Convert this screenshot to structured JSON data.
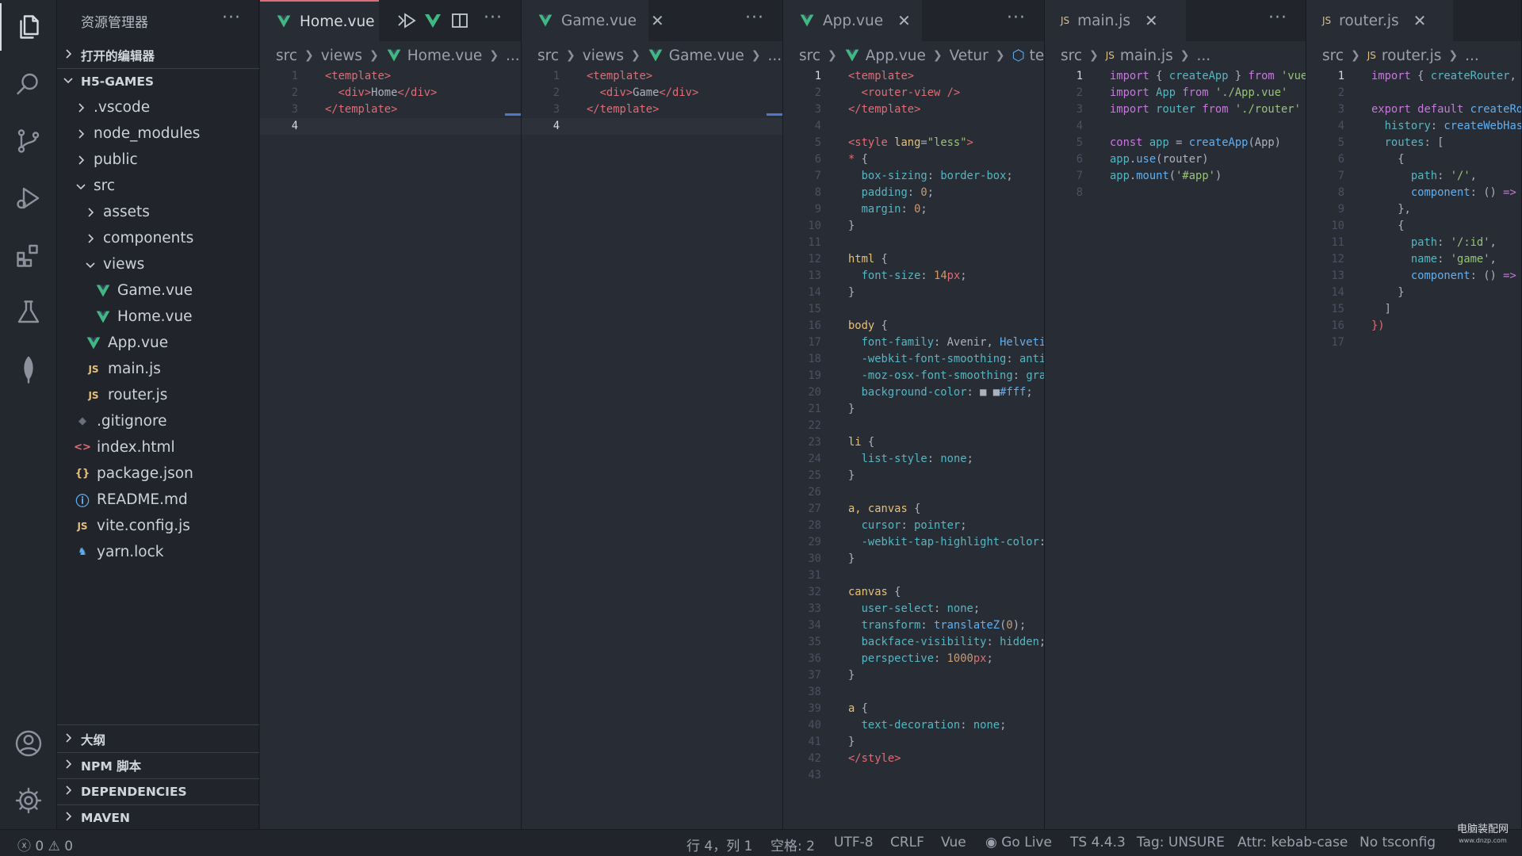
{
  "sidebar": {
    "title": "资源管理器",
    "more": "···",
    "open_editors": "打开的编辑器",
    "project": "H5-GAMES",
    "tree": [
      {
        "label": ".vscode",
        "type": "folder"
      },
      {
        "label": "node_modules",
        "type": "folder"
      },
      {
        "label": "public",
        "type": "folder"
      },
      {
        "label": "src",
        "type": "folder-open"
      },
      {
        "label": "assets",
        "type": "folder"
      },
      {
        "label": "components",
        "type": "folder"
      },
      {
        "label": "views",
        "type": "folder-open"
      },
      {
        "label": "Game.vue",
        "type": "vue"
      },
      {
        "label": "Home.vue",
        "type": "vue"
      },
      {
        "label": "App.vue",
        "type": "vue"
      },
      {
        "label": "main.js",
        "type": "js"
      },
      {
        "label": "router.js",
        "type": "js"
      },
      {
        "label": ".gitignore",
        "type": "git"
      },
      {
        "label": "index.html",
        "type": "html"
      },
      {
        "label": "package.json",
        "type": "json"
      },
      {
        "label": "README.md",
        "type": "info"
      },
      {
        "label": "vite.config.js",
        "type": "js"
      },
      {
        "label": "yarn.lock",
        "type": "yarn"
      }
    ],
    "sections": [
      "大纲",
      "NPM 脚本",
      "DEPENDENCIES",
      "MAVEN"
    ]
  },
  "editors": [
    {
      "tab": "Home.vue",
      "crumbs": [
        "src",
        "views",
        "Home.vue",
        "..."
      ],
      "lines": [
        [
          [
            "t-tag",
            "<template>"
          ]
        ],
        [
          [
            "t-plain",
            "  "
          ],
          [
            "t-tag",
            "<div>"
          ],
          [
            "t-plain",
            "Home"
          ],
          [
            "t-tag",
            "</div>"
          ]
        ],
        [
          [
            "t-tag",
            "</template>"
          ]
        ],
        []
      ]
    },
    {
      "tab": "Game.vue",
      "crumbs": [
        "src",
        "views",
        "Game.vue",
        "..."
      ],
      "lines": [
        [
          [
            "t-tag",
            "<template>"
          ]
        ],
        [
          [
            "t-plain",
            "  "
          ],
          [
            "t-tag",
            "<div>"
          ],
          [
            "t-plain",
            "Game"
          ],
          [
            "t-tag",
            "</div>"
          ]
        ],
        [
          [
            "t-tag",
            "</template>"
          ]
        ],
        []
      ]
    },
    {
      "tab": "App.vue",
      "crumbs": [
        "src",
        "App.vue",
        "Vetur",
        "tem"
      ],
      "lines": [
        [
          [
            "t-tag",
            "<template>"
          ]
        ],
        [
          [
            "t-plain",
            "  "
          ],
          [
            "t-tag",
            "<router-view />"
          ]
        ],
        [
          [
            "t-tag",
            "</template>"
          ]
        ],
        [],
        [
          [
            "t-tag",
            "<style "
          ],
          [
            "t-sel",
            "lang"
          ],
          [
            "t-plain",
            "="
          ],
          [
            "t-str",
            "\"less\""
          ],
          [
            "t-tag",
            ">"
          ]
        ],
        [
          [
            "t-tag",
            "* "
          ],
          [
            "t-plain",
            "{"
          ]
        ],
        [
          [
            "t-plain",
            "  "
          ],
          [
            "t-prop",
            "box-sizing"
          ],
          [
            "t-plain",
            ": "
          ],
          [
            "t-prop",
            "border-box"
          ],
          [
            "t-plain",
            ";"
          ]
        ],
        [
          [
            "t-plain",
            "  "
          ],
          [
            "t-prop",
            "padding"
          ],
          [
            "t-plain",
            ": "
          ],
          [
            "t-num",
            "0"
          ],
          [
            "t-plain",
            ";"
          ]
        ],
        [
          [
            "t-plain",
            "  "
          ],
          [
            "t-prop",
            "margin"
          ],
          [
            "t-plain",
            ": "
          ],
          [
            "t-num",
            "0"
          ],
          [
            "t-plain",
            ";"
          ]
        ],
        [
          [
            "t-plain",
            "}"
          ]
        ],
        [],
        [
          [
            "t-sel",
            "html "
          ],
          [
            "t-plain",
            "{"
          ]
        ],
        [
          [
            "t-plain",
            "  "
          ],
          [
            "t-prop",
            "font-size"
          ],
          [
            "t-plain",
            ": "
          ],
          [
            "t-num",
            "14"
          ],
          [
            "t-tag",
            "px"
          ],
          [
            "t-plain",
            ";"
          ]
        ],
        [
          [
            "t-plain",
            "}"
          ]
        ],
        [],
        [
          [
            "t-sel",
            "body "
          ],
          [
            "t-plain",
            "{"
          ]
        ],
        [
          [
            "t-plain",
            "  "
          ],
          [
            "t-prop",
            "font-family"
          ],
          [
            "t-plain",
            ": Avenir, "
          ],
          [
            "t-fn",
            "Helveti"
          ]
        ],
        [
          [
            "t-plain",
            "  "
          ],
          [
            "t-prop",
            "-webkit-font-smoothing"
          ],
          [
            "t-plain",
            ": "
          ],
          [
            "t-prop",
            "anti"
          ]
        ],
        [
          [
            "t-plain",
            "  "
          ],
          [
            "t-prop",
            "-moz-osx-font-smoothing"
          ],
          [
            "t-plain",
            ": "
          ],
          [
            "t-prop",
            "gra"
          ]
        ],
        [
          [
            "t-plain",
            "  "
          ],
          [
            "t-prop",
            "background-color"
          ],
          [
            "t-plain",
            ": "
          ],
          [
            "t-plain",
            "■"
          ],
          [
            "t-plain",
            " ■"
          ],
          [
            "t-fn",
            "#fff"
          ],
          [
            "t-plain",
            ";"
          ]
        ],
        [
          [
            "t-plain",
            "}"
          ]
        ],
        [],
        [
          [
            "t-sel",
            "li "
          ],
          [
            "t-plain",
            "{"
          ]
        ],
        [
          [
            "t-plain",
            "  "
          ],
          [
            "t-prop",
            "list-style"
          ],
          [
            "t-plain",
            ": "
          ],
          [
            "t-prop",
            "none"
          ],
          [
            "t-plain",
            ";"
          ]
        ],
        [
          [
            "t-plain",
            "}"
          ]
        ],
        [],
        [
          [
            "t-sel",
            "a, canvas "
          ],
          [
            "t-plain",
            "{"
          ]
        ],
        [
          [
            "t-plain",
            "  "
          ],
          [
            "t-prop",
            "cursor"
          ],
          [
            "t-plain",
            ": "
          ],
          [
            "t-prop",
            "pointer"
          ],
          [
            "t-plain",
            ";"
          ]
        ],
        [
          [
            "t-plain",
            "  "
          ],
          [
            "t-prop",
            "-webkit-tap-highlight-color"
          ],
          [
            "t-plain",
            ":"
          ]
        ],
        [
          [
            "t-plain",
            "}"
          ]
        ],
        [],
        [
          [
            "t-sel",
            "canvas "
          ],
          [
            "t-plain",
            "{"
          ]
        ],
        [
          [
            "t-plain",
            "  "
          ],
          [
            "t-prop",
            "user-select"
          ],
          [
            "t-plain",
            ": "
          ],
          [
            "t-prop",
            "none"
          ],
          [
            "t-plain",
            ";"
          ]
        ],
        [
          [
            "t-plain",
            "  "
          ],
          [
            "t-prop",
            "transform"
          ],
          [
            "t-plain",
            ": "
          ],
          [
            "t-fn",
            "translateZ"
          ],
          [
            "t-plain",
            "("
          ],
          [
            "t-num",
            "0"
          ],
          [
            "t-plain",
            ");"
          ]
        ],
        [
          [
            "t-plain",
            "  "
          ],
          [
            "t-prop",
            "backface-visibility"
          ],
          [
            "t-plain",
            ": "
          ],
          [
            "t-prop",
            "hidden"
          ],
          [
            "t-plain",
            ";"
          ]
        ],
        [
          [
            "t-plain",
            "  "
          ],
          [
            "t-prop",
            "perspective"
          ],
          [
            "t-plain",
            ": "
          ],
          [
            "t-num",
            "1000"
          ],
          [
            "t-tag",
            "px"
          ],
          [
            "t-plain",
            ";"
          ]
        ],
        [
          [
            "t-plain",
            "}"
          ]
        ],
        [],
        [
          [
            "t-sel",
            "a "
          ],
          [
            "t-plain",
            "{"
          ]
        ],
        [
          [
            "t-plain",
            "  "
          ],
          [
            "t-prop",
            "text-decoration"
          ],
          [
            "t-plain",
            ": "
          ],
          [
            "t-prop",
            "none"
          ],
          [
            "t-plain",
            ";"
          ]
        ],
        [
          [
            "t-plain",
            "}"
          ]
        ],
        [
          [
            "t-tag",
            "</style>"
          ]
        ],
        []
      ]
    },
    {
      "tab": "main.js",
      "crumbs": [
        "src",
        "main.js",
        "..."
      ],
      "lines": [
        [
          [
            "t-kw",
            "import "
          ],
          [
            "t-plain",
            "{ "
          ],
          [
            "t-prop",
            "createApp"
          ],
          [
            "t-plain",
            " } "
          ],
          [
            "t-kw",
            "from "
          ],
          [
            "t-str",
            "'vue"
          ]
        ],
        [
          [
            "t-kw",
            "import "
          ],
          [
            "t-prop",
            "App "
          ],
          [
            "t-kw",
            "from "
          ],
          [
            "t-str",
            "'./App.vue'"
          ]
        ],
        [
          [
            "t-kw",
            "import "
          ],
          [
            "t-prop",
            "router "
          ],
          [
            "t-kw",
            "from "
          ],
          [
            "t-str",
            "'./router'"
          ]
        ],
        [],
        [
          [
            "t-kw",
            "const "
          ],
          [
            "t-prop",
            "app"
          ],
          [
            "t-plain",
            " = "
          ],
          [
            "t-fn",
            "createApp"
          ],
          [
            "t-plain",
            "(App)"
          ]
        ],
        [
          [
            "t-prop",
            "app"
          ],
          [
            "t-plain",
            "."
          ],
          [
            "t-fn",
            "use"
          ],
          [
            "t-plain",
            "(router)"
          ]
        ],
        [
          [
            "t-prop",
            "app"
          ],
          [
            "t-plain",
            "."
          ],
          [
            "t-fn",
            "mount"
          ],
          [
            "t-plain",
            "("
          ],
          [
            "t-str",
            "'#app'"
          ],
          [
            "t-plain",
            ")"
          ]
        ],
        []
      ]
    },
    {
      "tab": "router.js",
      "crumbs": [
        "src",
        "router.js",
        "..."
      ],
      "lines": [
        [
          [
            "t-kw",
            "import "
          ],
          [
            "t-plain",
            "{ "
          ],
          [
            "t-prop",
            "createRouter"
          ],
          [
            "t-plain",
            ","
          ]
        ],
        [],
        [
          [
            "t-kw",
            "export default "
          ],
          [
            "t-fn",
            "createRo"
          ]
        ],
        [
          [
            "t-plain",
            "  "
          ],
          [
            "t-prop",
            "history"
          ],
          [
            "t-plain",
            ": "
          ],
          [
            "t-fn",
            "createWebHas"
          ]
        ],
        [
          [
            "t-plain",
            "  "
          ],
          [
            "t-prop",
            "routes"
          ],
          [
            "t-plain",
            ": ["
          ]
        ],
        [
          [
            "t-plain",
            "    {"
          ]
        ],
        [
          [
            "t-plain",
            "      "
          ],
          [
            "t-prop",
            "path"
          ],
          [
            "t-plain",
            ": "
          ],
          [
            "t-str",
            "'/'"
          ],
          [
            "t-plain",
            ","
          ]
        ],
        [
          [
            "t-plain",
            "      "
          ],
          [
            "t-fn",
            "component"
          ],
          [
            "t-plain",
            ": () "
          ],
          [
            "t-kw",
            "=>"
          ]
        ],
        [
          [
            "t-plain",
            "    },"
          ]
        ],
        [
          [
            "t-plain",
            "    {"
          ]
        ],
        [
          [
            "t-plain",
            "      "
          ],
          [
            "t-prop",
            "path"
          ],
          [
            "t-plain",
            ": "
          ],
          [
            "t-str",
            "'/:id'"
          ],
          [
            "t-plain",
            ","
          ]
        ],
        [
          [
            "t-plain",
            "      "
          ],
          [
            "t-prop",
            "name"
          ],
          [
            "t-plain",
            ": "
          ],
          [
            "t-str",
            "'game'"
          ],
          [
            "t-plain",
            ","
          ]
        ],
        [
          [
            "t-plain",
            "      "
          ],
          [
            "t-fn",
            "component"
          ],
          [
            "t-plain",
            ": () "
          ],
          [
            "t-kw",
            "=>"
          ]
        ],
        [
          [
            "t-plain",
            "    }"
          ]
        ],
        [
          [
            "t-plain",
            "  ]"
          ]
        ],
        [
          [
            "t-tag",
            "})"
          ]
        ],
        []
      ]
    }
  ],
  "status": {
    "errors": "0",
    "warnings": "0",
    "position": "行 4，列 1",
    "spaces": "空格: 2",
    "encoding": "UTF-8",
    "eol": "CRLF",
    "language": "Vue",
    "golive": "Go Live",
    "ts": "TS 4.4.3",
    "tag": "Tag: UNSURE",
    "attr": "Attr: kebab-case",
    "tsconfig": "No tsconfig"
  },
  "watermark": {
    "title": "电脑装配网",
    "url": "www.dnzp.com"
  }
}
